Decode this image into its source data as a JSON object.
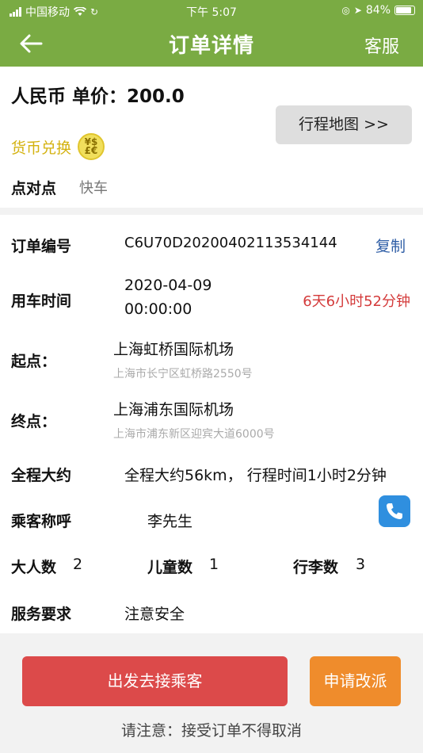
{
  "status": {
    "carrier": "中国移动",
    "time": "下午 5:07",
    "battery": "84%"
  },
  "nav": {
    "title": "订单详情",
    "service": "客服"
  },
  "top": {
    "price": "人民币 单价：200.0",
    "map_button": "行程地图 >>",
    "currency_exchange": "货币兑换",
    "coin_symbols": "¥$\n£€",
    "trip_type_label": "点对点",
    "trip_type_value": "快车"
  },
  "order": {
    "number_label": "订单编号",
    "number": "C6U70D20200402113534144",
    "copy": "复制",
    "time_label": "用车时间",
    "date": "2020-04-09",
    "time": "00:00:00",
    "countdown": "6天6小时52分钟",
    "start_label": "起点：",
    "start_name": "上海虹桥国际机场",
    "start_addr": "上海市长宁区虹桥路2550号",
    "end_label": "终点：",
    "end_name": "上海浦东国际机场",
    "end_addr": "上海市浦东新区迎宾大道6000号",
    "distance_label": "全程大约",
    "distance": "全程大约56km， 行程时间1小时2分钟",
    "passenger_label": "乘客称呼",
    "passenger": "李先生",
    "adults_label": "大人数",
    "adults": "2",
    "children_label": "儿童数",
    "children": "1",
    "luggage_label": "行李数",
    "luggage": "3",
    "service_label": "服务要求",
    "service": "注意安全"
  },
  "actions": {
    "depart": "出发去接乘客",
    "reassign": "申请改派",
    "notice": "请注意：接受订单不得取消"
  }
}
